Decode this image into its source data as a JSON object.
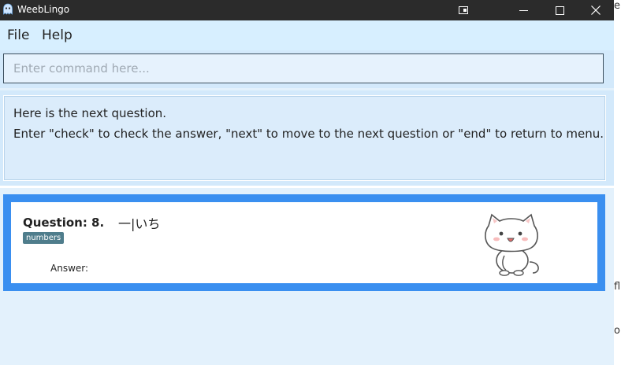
{
  "window": {
    "title": "WeebLingo"
  },
  "titlebar_icons": {
    "app": "ghost-app-icon",
    "extra": "snap-layout-icon",
    "minimize": "minimize-icon",
    "maximize": "maximize-icon",
    "close": "close-icon"
  },
  "menu": {
    "items": [
      {
        "label": "File"
      },
      {
        "label": "Help"
      }
    ]
  },
  "command": {
    "placeholder": "Enter command here...",
    "value": ""
  },
  "result": {
    "lines": [
      "Here is the next question.",
      "Enter \"check\" to check the answer, \"next\" to move to the next question or \"end\" to return to menu."
    ]
  },
  "flashcard": {
    "question_label": "Question: 8.",
    "question_text": "一|いち",
    "tag": "numbers",
    "answer_label": "Answer:",
    "image": "cute-cat-sticker"
  },
  "edge_fragments": {
    "top": "e",
    "mid": "fl",
    "bottom": "or"
  },
  "colors": {
    "card_border": "#3a8ff0",
    "titlebar": "#2b2b2b",
    "tag": "#4f7d8c",
    "background": "#e3f1fc"
  }
}
